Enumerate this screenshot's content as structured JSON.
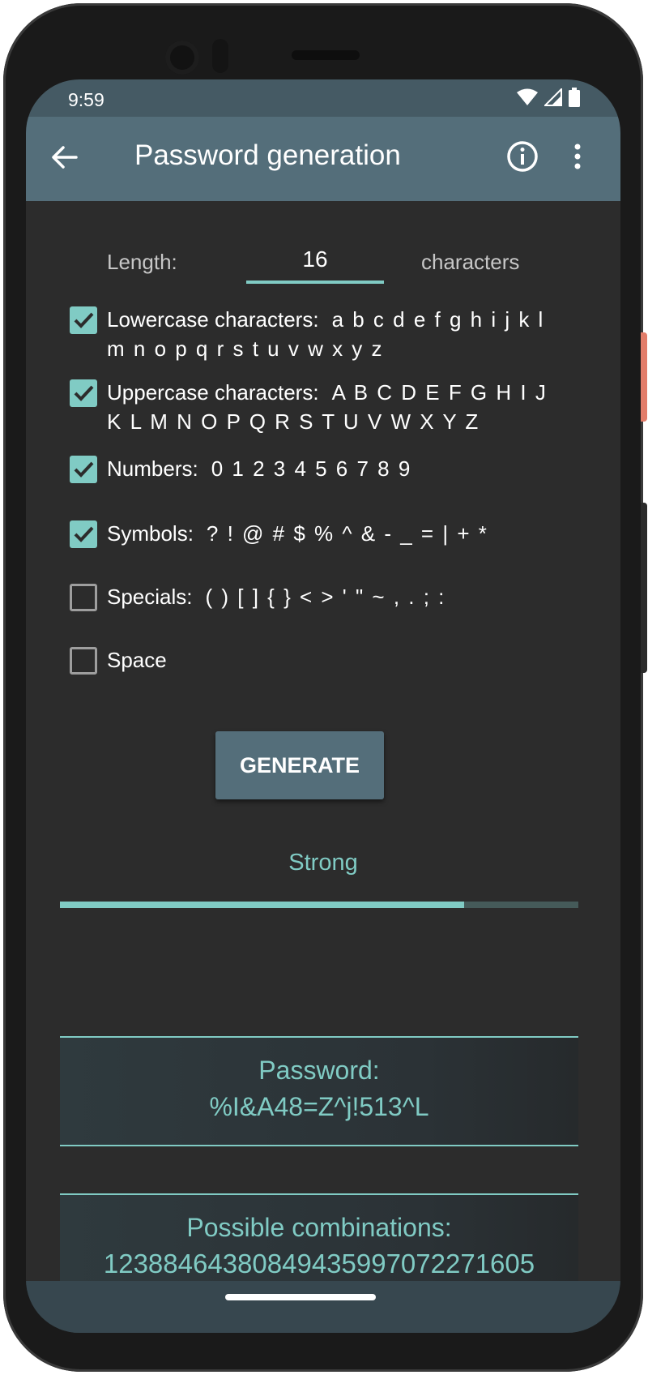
{
  "status_bar": {
    "time": "9:59",
    "icons": [
      "wifi-icon",
      "cellular-signal-icon",
      "battery-icon"
    ]
  },
  "app_bar": {
    "title": "Password generation",
    "back_icon": "arrow-back-icon",
    "info_icon": "info-icon",
    "menu_icon": "more-vert-icon"
  },
  "length": {
    "label": "Length:",
    "value": "16",
    "unit": "characters"
  },
  "options": [
    {
      "name": "Lowercase characters:",
      "chars": "a b c d e f g h i j k l m n o p q r s t u v w x y z",
      "checked": true
    },
    {
      "name": "Uppercase characters:",
      "chars": "A B C D E F G H I J K L M N O P Q R S T U V W X Y Z",
      "checked": true
    },
    {
      "name": "Numbers:",
      "chars": "0 1 2 3 4 5 6 7 8 9",
      "checked": true
    },
    {
      "name": "Symbols:",
      "chars": "? ! @ # $ % ^ & - _ = | + *",
      "checked": true
    },
    {
      "name": "Specials:",
      "chars": "( ) [ ] { } < > ' \" ~ , . ; :",
      "checked": false
    },
    {
      "name": "Space",
      "chars": "",
      "checked": false
    }
  ],
  "generate": {
    "label": "GENERATE"
  },
  "strength": {
    "label": "Strong",
    "fraction": 0.78
  },
  "password": {
    "title": "Password:",
    "value": "%I&A48=Z^j!513^L"
  },
  "combinations": {
    "title": "Possible combinations:",
    "value": "12388464380849435997072271605"
  },
  "colors": {
    "accent": "#80cbc4",
    "app_bar": "#546e7a",
    "status_bar": "#455a64",
    "background": "#2c2c2c"
  }
}
